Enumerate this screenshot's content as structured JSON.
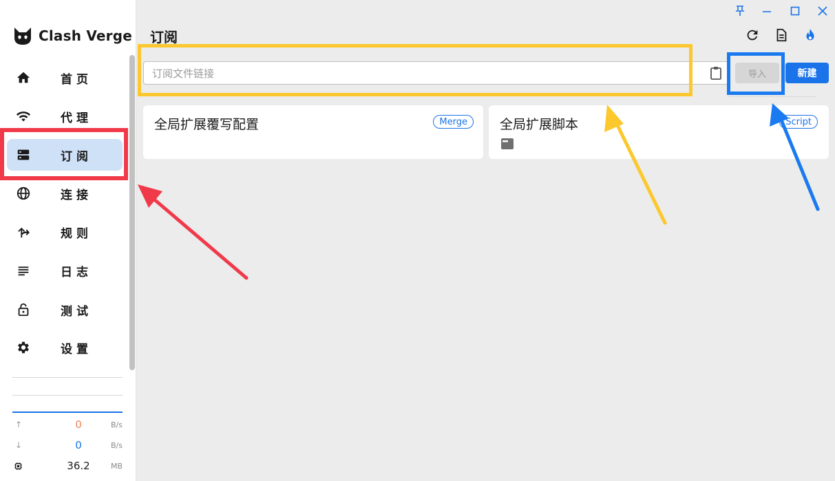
{
  "app": {
    "name": "Clash Verge"
  },
  "window_controls": [
    "pin-icon",
    "minimize-icon",
    "maximize-icon",
    "close-icon"
  ],
  "header": {
    "title": "订阅",
    "icons": [
      "refresh-icon",
      "document-icon",
      "flame-icon"
    ]
  },
  "sidebar": {
    "items": [
      {
        "label": "首页",
        "icon": "home-icon",
        "active": false
      },
      {
        "label": "代理",
        "icon": "wifi-icon",
        "active": false
      },
      {
        "label": "订阅",
        "icon": "storage-icon",
        "active": true
      },
      {
        "label": "连接",
        "icon": "globe-icon",
        "active": false
      },
      {
        "label": "规则",
        "icon": "fork-arrow-icon",
        "active": false
      },
      {
        "label": "日志",
        "icon": "lines-icon",
        "active": false
      },
      {
        "label": "测试",
        "icon": "lock-icon",
        "active": false
      },
      {
        "label": "设置",
        "icon": "gear-icon",
        "active": false
      }
    ],
    "traffic": {
      "upload": {
        "value": "0",
        "unit": "B/s",
        "color": "#f2825a"
      },
      "download": {
        "value": "0",
        "unit": "B/s",
        "color": "#1a73e8"
      },
      "memory": {
        "value": "36.2",
        "unit": "MB"
      }
    }
  },
  "search": {
    "placeholder": "订阅文件链接",
    "value": ""
  },
  "buttons": {
    "import_label": "导入",
    "new_label": "新建"
  },
  "cards": [
    {
      "title": "全局扩展覆写配置",
      "badge": "Merge",
      "has_file_icon": false
    },
    {
      "title": "全局扩展脚本",
      "badge": "Script",
      "has_file_icon": true
    }
  ],
  "annotation_colors": {
    "red": "#f03a4a",
    "yellow": "#fcc82e",
    "blue": "#1a7af0"
  },
  "colors": {
    "accent": "#1a73e8",
    "active_bg": "#cfe1f7"
  }
}
